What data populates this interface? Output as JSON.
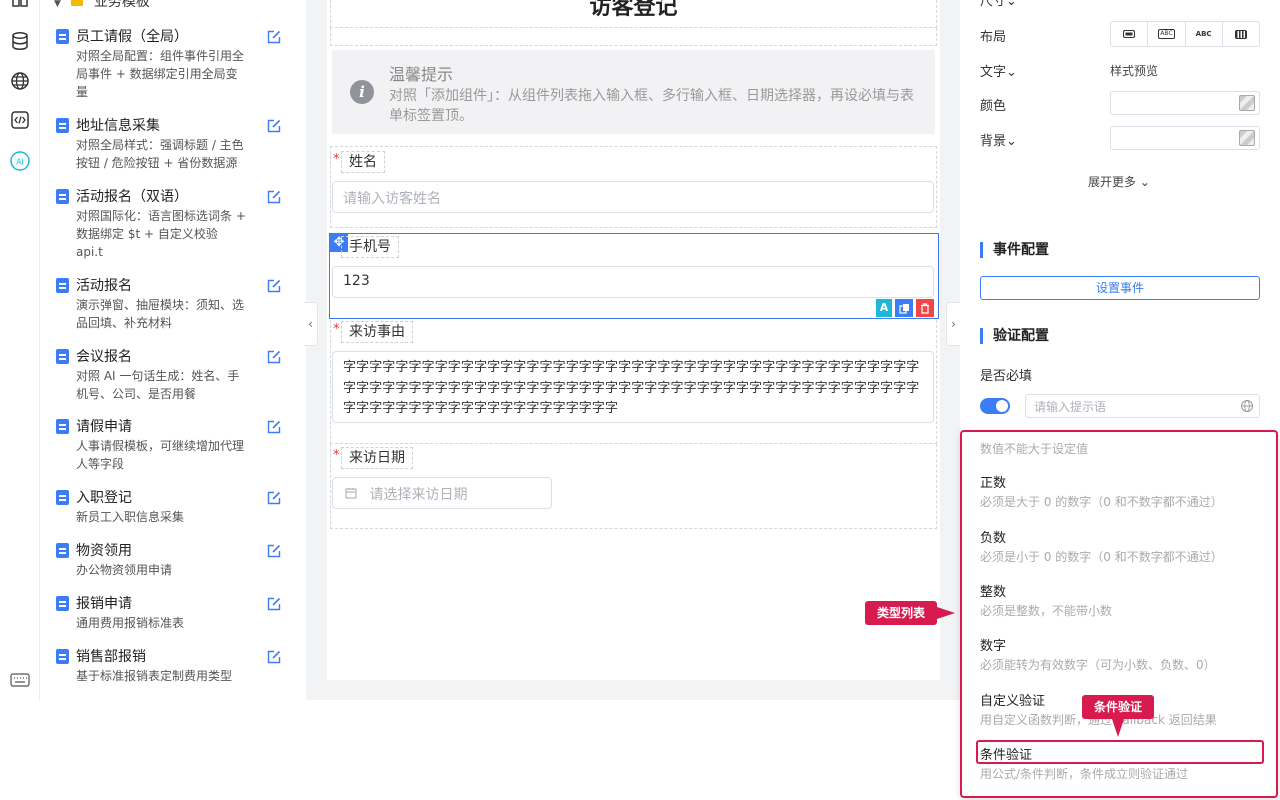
{
  "sidebar_group": {
    "label": "业务模板"
  },
  "templates": [
    {
      "title": "员工请假（全局）",
      "desc": "对照全局配置：组件事件引用全局事件 + 数据绑定引用全局变量"
    },
    {
      "title": "地址信息采集",
      "desc": "对照全局样式：强调标题 / 主色按钮 / 危险按钮 + 省份数据源"
    },
    {
      "title": "活动报名（双语）",
      "desc": "对照国际化：语言图标选词条 + 数据绑定 $t + 自定义校验 api.t"
    },
    {
      "title": "活动报名",
      "desc": "演示弹窗、抽屉模块：须知、选品回填、补充材料"
    },
    {
      "title": "会议报名",
      "desc": "对照 AI 一句话生成：姓名、手机号、公司、是否用餐"
    },
    {
      "title": "请假申请",
      "desc": "人事请假模板，可继续增加代理人等字段"
    },
    {
      "title": "入职登记",
      "desc": "新员工入职信息采集"
    },
    {
      "title": "物资领用",
      "desc": "办公物资领用申请"
    },
    {
      "title": "报销申请",
      "desc": "通用费用报销标准表"
    },
    {
      "title": "销售部报销",
      "desc": "基于标准报销表定制费用类型"
    }
  ],
  "form": {
    "title": "访客登记",
    "tip_title": "温馨提示",
    "tip_text": "对照「添加组件」：从组件列表拖入输入框、多行输入框、日期选择器，再设必填与表单标签置顶。",
    "required_mark": "*",
    "fields": {
      "name": {
        "label": "姓名",
        "placeholder": "请输入访客姓名"
      },
      "phone": {
        "label": "手机号",
        "value": "123"
      },
      "reason": {
        "label": "来访事由",
        "value": "字字字字字字字字字字字字字字字字字字字字字字字字字字字字字字字字字字字字字字字字字字字字字字字字字字字字字字字字字字字字字字字字字字字字字字字字字字字字字字字字字字字字字字字字字字字字字字字字字字字字字字字字字字字字字"
      },
      "date": {
        "label": "来访日期",
        "placeholder": "请选择来访日期"
      }
    }
  },
  "props": {
    "size_label": "尺寸",
    "layout_label": "布局",
    "layout_options": [
      "",
      "ABC",
      "ABC",
      ""
    ],
    "text_label": "文字",
    "style_preview": "样式预览",
    "color_label": "颜色",
    "bg_label": "背景",
    "expand_more": "展开更多",
    "event_section": "事件配置",
    "set_event_btn": "设置事件",
    "validation_section": "验证配置",
    "required_label": "是否必填",
    "hint_placeholder": "请输入提示语"
  },
  "validation_types": {
    "top_note": "数值不能大于设定值",
    "items": [
      {
        "title": "正数",
        "desc": "必须是大于 0 的数字（0 和不数字都不通过）"
      },
      {
        "title": "负数",
        "desc": "必须是小于 0 的数字（0 和不数字都不通过）"
      },
      {
        "title": "整数",
        "desc": "必须是整数，不能带小数"
      },
      {
        "title": "数字",
        "desc": "必须能转为有效数字（可为小数、负数、0）"
      },
      {
        "title": "自定义验证",
        "desc": "用自定义函数判断，通过 callback 返回结果"
      },
      {
        "title": "条件验证",
        "desc": "用公式/条件判断，条件成立则验证通过"
      }
    ]
  },
  "callouts": {
    "type_list": "类型列表",
    "condition": "条件验证"
  },
  "colors": {
    "accent": "#3c7cf4",
    "callout": "#d81b4f",
    "delete": "#f04646"
  }
}
